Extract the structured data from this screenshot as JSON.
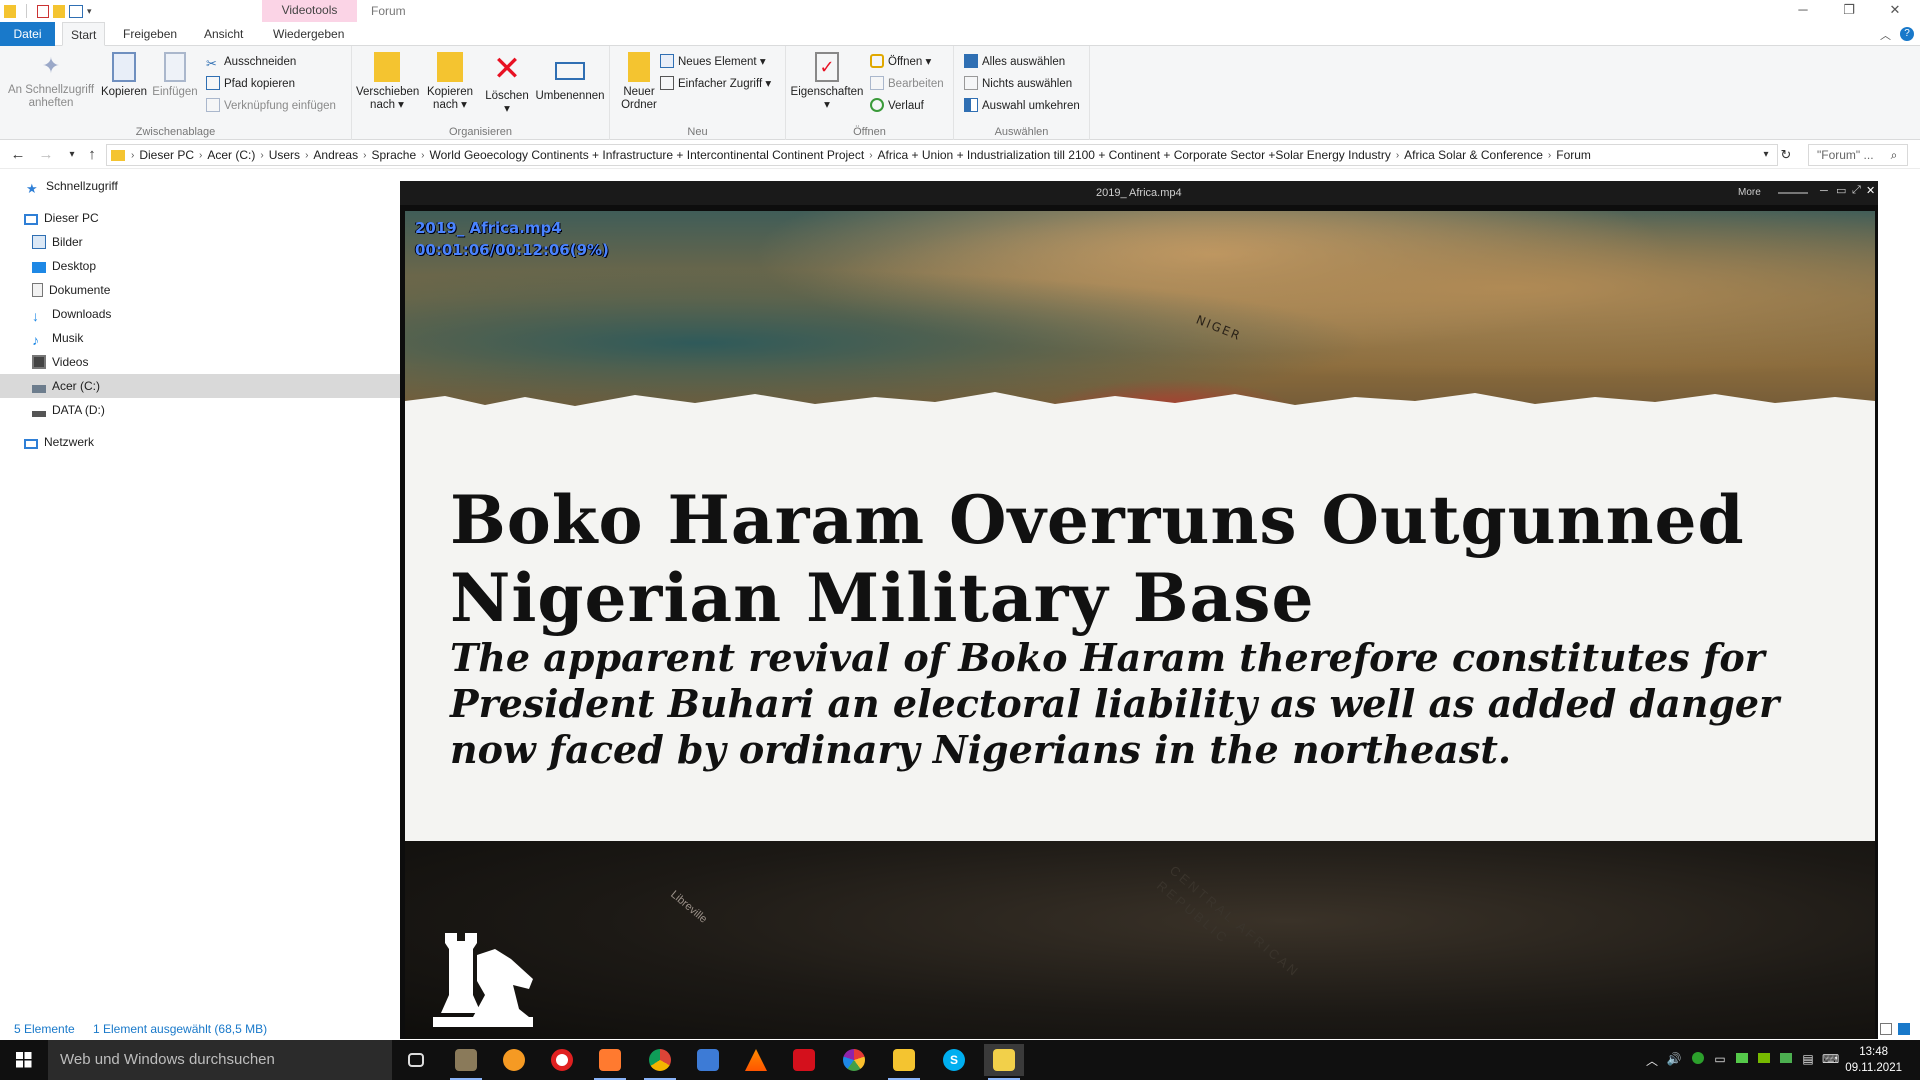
{
  "titlebar": {
    "contextual_tab": "Videotools",
    "window_title": "Forum",
    "minimize": "─",
    "restore": "❐",
    "close": "✕"
  },
  "ribbon_tabs": {
    "file": "Datei",
    "start": "Start",
    "share": "Freigeben",
    "view": "Ansicht",
    "play": "Wiedergeben",
    "help": "?"
  },
  "ribbon": {
    "clipboard": {
      "label": "Zwischenablage",
      "pin": "An Schnellzugriff anheften",
      "copy": "Kopieren",
      "paste": "Einfügen",
      "cut": "Ausschneiden",
      "copy_path": "Pfad kopieren",
      "paste_shortcut": "Verknüpfung einfügen"
    },
    "organize": {
      "label": "Organisieren",
      "move_to": "Verschieben nach",
      "copy_to": "Kopieren nach",
      "delete": "Löschen",
      "rename": "Umbenennen"
    },
    "new": {
      "label": "Neu",
      "new_folder": "Neuer Ordner",
      "new_item": "Neues Element",
      "easy_access": "Einfacher Zugriff"
    },
    "open": {
      "label": "Öffnen",
      "properties": "Eigenschaften",
      "open": "Öffnen",
      "edit": "Bearbeiten",
      "history": "Verlauf"
    },
    "select": {
      "label": "Auswählen",
      "select_all": "Alles auswählen",
      "select_none": "Nichts auswählen",
      "invert": "Auswahl umkehren"
    }
  },
  "address": {
    "crumbs": [
      "Dieser PC",
      "Acer (C:)",
      "Users",
      "Andreas",
      "Sprache",
      "World Geoecology Continents + Infrastructure + Intercontinental Continent Project",
      "Africa + Union + Industrialization till 2100 + Continent + Corporate Sector +Solar Energy Industry",
      "Africa Solar & Conference",
      "Forum"
    ],
    "search_placeholder": "\"Forum\" ..."
  },
  "navpane": {
    "quick_access": "Schnellzugriff",
    "this_pc": "Dieser PC",
    "items": [
      "Bilder",
      "Desktop",
      "Dokumente",
      "Downloads",
      "Musik",
      "Videos",
      "Acer (C:)",
      "DATA (D:)"
    ],
    "network": "Netzwerk"
  },
  "statusbar": {
    "count": "5 Elemente",
    "selection": "1 Element ausgewählt (68,5 MB)"
  },
  "player": {
    "title": "2019_ Africa.mp4",
    "more": "More",
    "osd_filename": "2019_ Africa.mp4",
    "osd_time": "00:01:06/00:12:06(9%)",
    "progress_fraction": 0.09,
    "headline": "Boko Haram Overruns Outgunned Nigerian Military Base",
    "subline": "The apparent revival of Boko Haram therefore constitutes for President Buhari an electoral liability as well as added danger now faced by ordinary Nigerians in the northeast.",
    "map_label_niger": "NIGER",
    "map_label_libreville": "Libreville",
    "map_label_car": "CENTRAL AFRICAN REPUBLIC"
  },
  "taskbar": {
    "search_placeholder": "Web und Windows durchsuchen",
    "time": "13:48",
    "date": "09.11.2021",
    "apps": [
      "task-view",
      "photo-viewer",
      "firefox-canary",
      "opera",
      "sublime",
      "chrome",
      "gallery",
      "vlc",
      "acrobat",
      "picasa",
      "file-explorer",
      "skype",
      "video-player"
    ]
  },
  "colors": {
    "accent": "#1979ca",
    "context_tab": "#fbd4e6",
    "osd_text": "#4a84ff",
    "delete_red": "#e81123"
  }
}
